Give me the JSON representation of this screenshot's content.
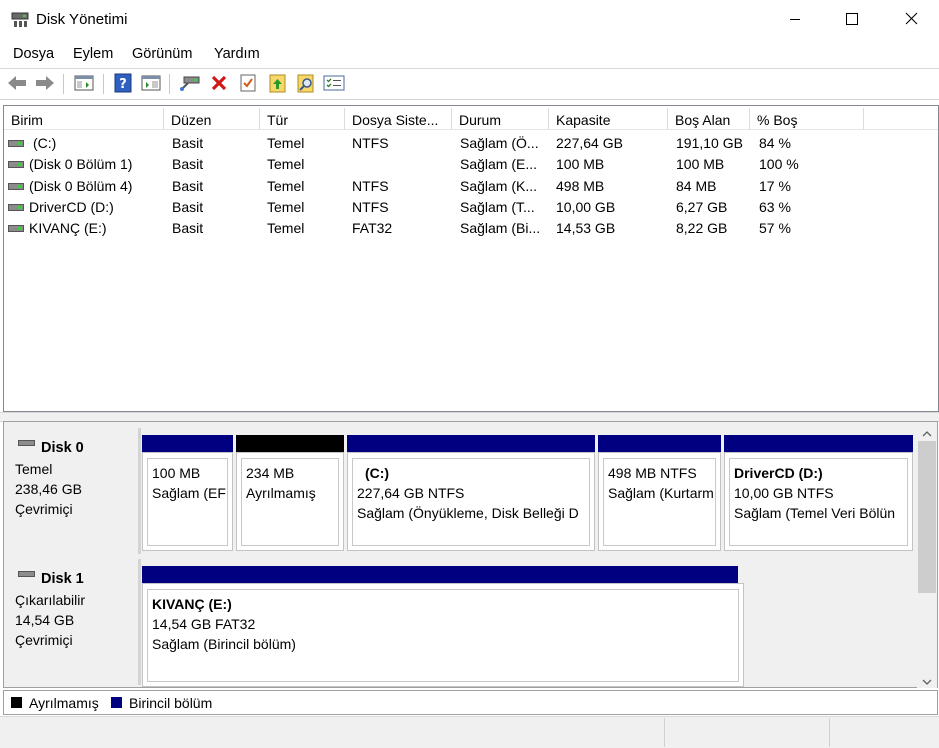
{
  "window": {
    "title": "Disk Yönetimi",
    "minimize_icon": "minimize-icon",
    "maximize_icon": "maximize-icon",
    "close_icon": "close-icon"
  },
  "menu": [
    "Dosya",
    "Eylem",
    "Görünüm",
    "Yardım"
  ],
  "toolbar": [
    "back-arrow-icon",
    "forward-arrow-icon",
    "console-tree-icon",
    "help-icon",
    "action-pane-icon",
    "connect-disk-icon",
    "delete-icon",
    "check-icon",
    "folder-up-icon",
    "folder-search-icon",
    "properties-list-icon"
  ],
  "volumes": {
    "columns": [
      "Birim",
      "Düzen",
      "Tür",
      "Dosya Siste...",
      "Durum",
      "Kapasite",
      "Boş Alan",
      "% Boş"
    ],
    "rows": [
      [
        "(C:)",
        "Basit",
        "Temel",
        "NTFS",
        "Sağlam (Ö...",
        "227,64 GB",
        "191,10 GB",
        "84 %"
      ],
      [
        "(Disk 0 Bölüm 1)",
        "Basit",
        "Temel",
        "",
        "Sağlam (E...",
        "100 MB",
        "100 MB",
        "100 %"
      ],
      [
        "(Disk 0 Bölüm 4)",
        "Basit",
        "Temel",
        "NTFS",
        "Sağlam (K...",
        "498 MB",
        "84 MB",
        "17 %"
      ],
      [
        "DriverCD (D:)",
        "Basit",
        "Temel",
        "NTFS",
        "Sağlam (T...",
        "10,00 GB",
        "6,27 GB",
        "63 %"
      ],
      [
        "KIVANÇ (E:)",
        "Basit",
        "Temel",
        "FAT32",
        "Sağlam (Bi...",
        "14,53 GB",
        "8,22 GB",
        "57 %"
      ]
    ]
  },
  "disks": [
    {
      "name": "Disk 0",
      "type": "Temel",
      "size": "238,46 GB",
      "state": "Çevrimiçi",
      "partitions": [
        {
          "name": "",
          "line1": "100 MB",
          "line2": "Sağlam (EF",
          "kind": "primary"
        },
        {
          "name": "",
          "line1": "234 MB",
          "line2": "Ayrılmamış",
          "kind": "unallocated"
        },
        {
          "name": "(C:)",
          "line1": "227,64 GB NTFS",
          "line2": "Sağlam (Önyükleme, Disk Belleği D",
          "kind": "primary"
        },
        {
          "name": "",
          "line1": "498 MB NTFS",
          "line2": "Sağlam (Kurtarm",
          "kind": "primary"
        },
        {
          "name": "DriverCD  (D:)",
          "line1": "10,00 GB NTFS",
          "line2": "Sağlam (Temel Veri Bölün",
          "kind": "primary"
        }
      ]
    },
    {
      "name": "Disk 1",
      "type": "Çıkarılabilir",
      "size": "14,54 GB",
      "state": "Çevrimiçi",
      "partitions": [
        {
          "name": "KIVANÇ  (E:)",
          "line1": "14,54 GB FAT32",
          "line2": "Sağlam (Birincil bölüm)",
          "kind": "primary"
        }
      ]
    }
  ],
  "legend": [
    {
      "label": "Ayrılmamış",
      "color": "#000000"
    },
    {
      "label": "Birincil bölüm",
      "color": "#000080"
    }
  ],
  "colors": {
    "primary": "#000080",
    "unallocated": "#000000"
  }
}
